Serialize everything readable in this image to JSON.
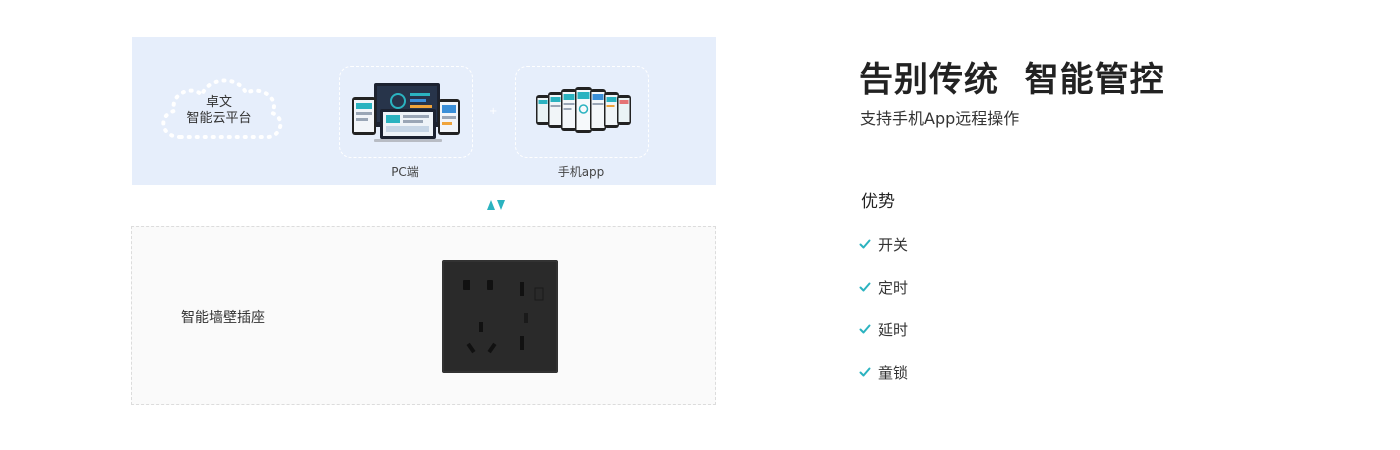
{
  "platform": {
    "cloud_line1": "卓文",
    "cloud_line2": "智能云平台",
    "pc_label": "PC端",
    "app_label": "手机app",
    "plus": "+"
  },
  "socket": {
    "label": "智能墙壁插座"
  },
  "hero": {
    "title": "告别传统  智能管控",
    "subtitle": "支持手机App远程操作"
  },
  "advantages": {
    "title": "优势",
    "items": [
      "开关",
      "定时",
      "延时",
      "童锁"
    ]
  },
  "colors": {
    "accent": "#2bb3c0",
    "panel_bg": "#e6eefb",
    "socket_face": "#2a2a2a"
  }
}
